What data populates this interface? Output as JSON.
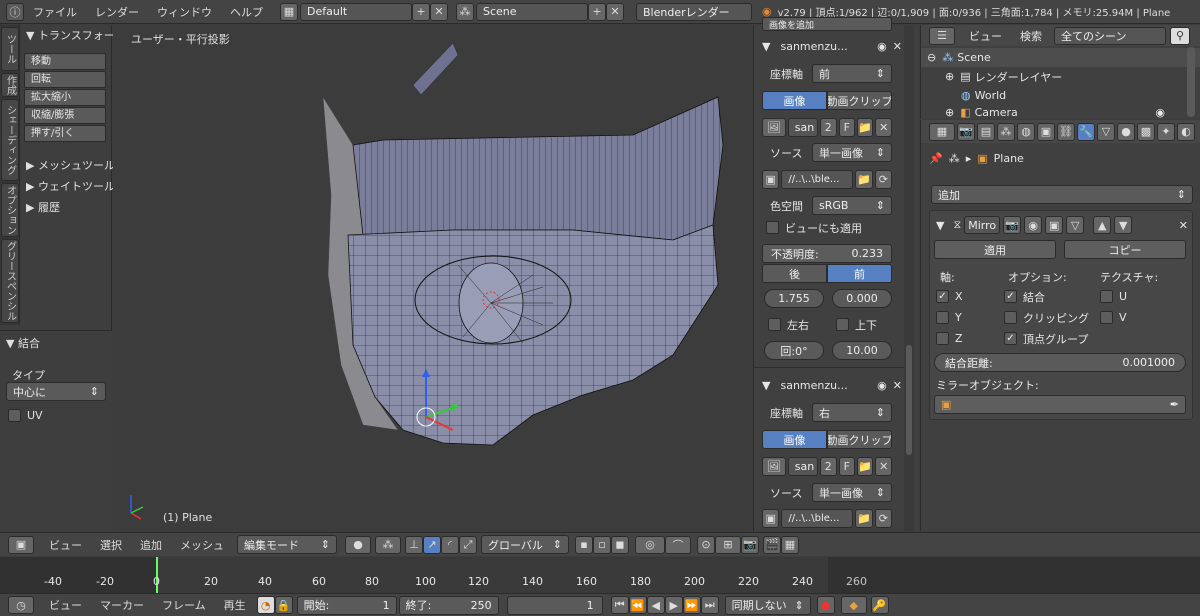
{
  "topbar": {
    "menus": [
      "ファイル",
      "レンダー",
      "ウィンドウ",
      "ヘルプ"
    ],
    "layout": "Default",
    "scene": "Scene",
    "engine": "Blenderレンダー",
    "stats": "v2.79 | 頂点:1/962 | 辺:0/1,909 | 面:0/936 | 三角面:1,784 | メモリ:25.94M | Plane"
  },
  "toolshelf": {
    "tabs": [
      "ツール",
      "作成",
      "シェーディング",
      "オプション",
      "グリースペンシル"
    ],
    "transform_header": "トランスフォーム",
    "buttons": [
      "移動",
      "回転",
      "拡大縮小",
      "収縮/膨張",
      "押す/引く"
    ],
    "sections": [
      "メッシュツール",
      "ウェイトツール",
      "履歴"
    ],
    "op_header": "結合",
    "type_label": "タイプ",
    "type_value": "中心に",
    "uv_label": "UV"
  },
  "viewport": {
    "view_label": "ユーザー・平行投影",
    "object_label": "(1) Plane"
  },
  "npanel": {
    "top_cut": "画像を追加",
    "bg1": {
      "name": "sanmenzu...",
      "axis_label": "座標軸",
      "axis_value": "前",
      "tab_image": "画像",
      "tab_movie": "動画クリップ",
      "img_name": "san",
      "img_users": "2",
      "img_fake": "F",
      "source_label": "ソース",
      "source_value": "単一画像",
      "path": "//..\\..\\ble...",
      "colorspace_label": "色空間",
      "colorspace_value": "sRGB",
      "view_apply": "ビューにも適用",
      "opacity_label": "不透明度:",
      "opacity_value": "0.233",
      "back": "後",
      "front": "前",
      "x_value": "1.755",
      "y_value": "0.000",
      "flip_x": "左右",
      "flip_y": "上下",
      "rotation": "回:0°",
      "size": "10.00"
    },
    "bg2": {
      "name": "sanmenzu...",
      "axis_label": "座標軸",
      "axis_value": "右",
      "tab_image": "画像",
      "tab_movie": "動画クリップ",
      "img_name": "san",
      "img_users": "2",
      "img_fake": "F",
      "source_label": "ソース",
      "source_value": "単一画像",
      "path": "//..\\..\\ble..."
    }
  },
  "outliner": {
    "view": "ビュー",
    "search": "検索",
    "filter": "全てのシーン",
    "items": [
      "Scene",
      "レンダーレイヤー",
      "World",
      "Camera"
    ]
  },
  "props": {
    "object_name": "Plane",
    "add_modifier": "追加",
    "modifier_name": "Mirro",
    "apply": "適用",
    "copy": "コピー",
    "axis_header": "軸:",
    "options_header": "オプション:",
    "texture_header": "テクスチャ:",
    "axes": [
      "X",
      "Y",
      "Z"
    ],
    "options": [
      "結合",
      "クリッピング",
      "頂点グループ"
    ],
    "tex": [
      "U",
      "V"
    ],
    "merge_label": "結合距離:",
    "merge_value": "0.001000",
    "mirror_object": "ミラーオブジェクト:"
  },
  "hdr": {
    "menus": [
      "ビュー",
      "選択",
      "追加",
      "メッシュ"
    ],
    "mode": "編集モード",
    "orientation": "グローバル"
  },
  "timeline": {
    "ticks": [
      "-40",
      "-20",
      "0",
      "20",
      "40",
      "60",
      "80",
      "100",
      "120",
      "140",
      "160",
      "180",
      "200",
      "220",
      "240",
      "260"
    ],
    "menus": [
      "ビュー",
      "マーカー",
      "フレーム",
      "再生"
    ],
    "start_label": "開始:",
    "start_value": "1",
    "end_label": "終了:",
    "end_value": "250",
    "current": "1",
    "sync": "同期しない"
  },
  "colors": {
    "accent": "#5680c2",
    "mesh": "#8a8ea8"
  }
}
